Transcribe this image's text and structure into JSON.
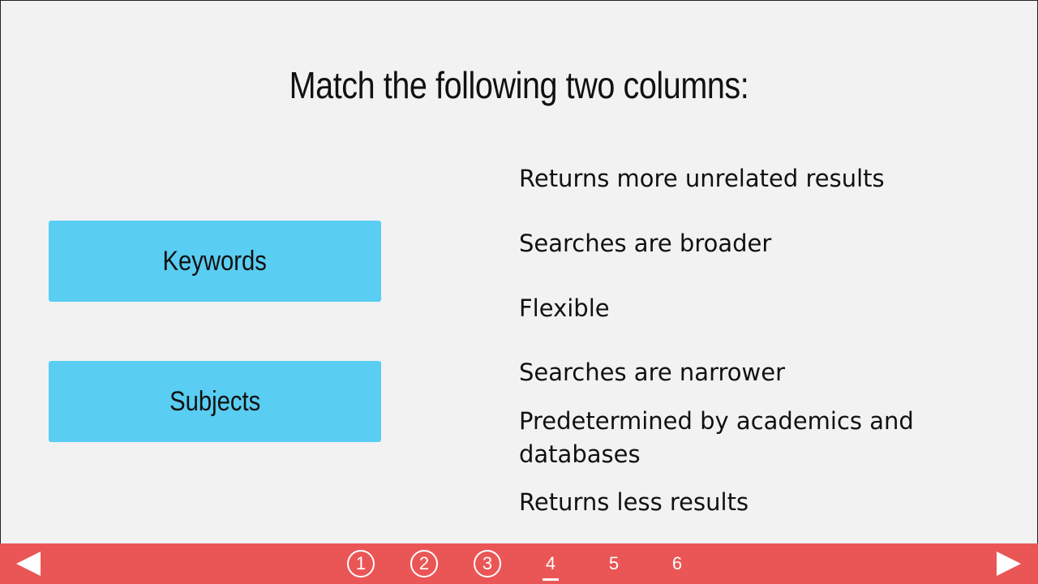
{
  "title": "Match the following two columns:",
  "left_column": [
    {
      "label": "Keywords"
    },
    {
      "label": "Subjects"
    }
  ],
  "right_column": [
    {
      "label": "Returns more unrelated results"
    },
    {
      "label": "Searches are broader"
    },
    {
      "label": "Flexible"
    },
    {
      "label": "Searches are narrower"
    },
    {
      "label": "Predetermined by academics and databases"
    },
    {
      "label": "Returns less results"
    }
  ],
  "pager": {
    "pages": [
      "1",
      "2",
      "3",
      "4",
      "5",
      "6"
    ],
    "completed": [
      1,
      2,
      3
    ],
    "current": 4
  },
  "colors": {
    "background": "#f2f2f2",
    "box": "#59cdf2",
    "bar": "#ea5656",
    "text": "#111111"
  }
}
